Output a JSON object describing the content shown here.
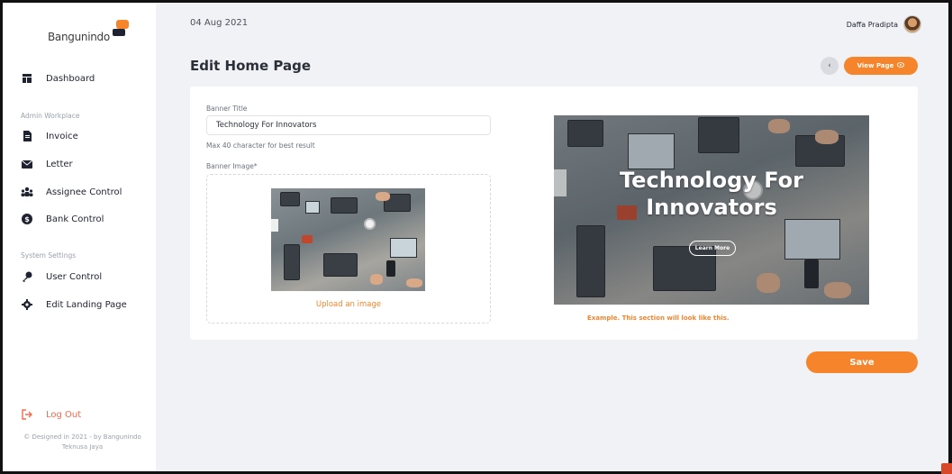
{
  "brand": {
    "name": "Bangunindo"
  },
  "sidebar": {
    "dashboard": "Dashboard",
    "admin_section": "Admin Workplace",
    "admin_items": [
      "Invoice",
      "Letter",
      "Assignee Control",
      "Bank Control"
    ],
    "system_section": "System Settings",
    "system_items": [
      "User Control",
      "Edit Landing Page"
    ],
    "logout": "Log Out",
    "footer_line1": "© Designed in 2021 - by Bangunindo",
    "footer_line2": "Teknusa Jaya"
  },
  "header": {
    "date": "04 Aug 2021",
    "user_name": "Daffa Pradipta",
    "page_title": "Edit Home Page",
    "view_page_label": "View Page"
  },
  "form": {
    "banner_title_label": "Banner Title",
    "banner_title_value": "Technology For Innovators",
    "banner_title_hint": "Max 40 character for best result",
    "banner_image_label": "Banner Image*",
    "upload_label": "Upload an image"
  },
  "preview": {
    "title_line1": "Technology For",
    "title_line2": "Innovators",
    "button_label": "Learn More",
    "example_note": "Example. This section will look like this."
  },
  "actions": {
    "save_label": "Save"
  },
  "colors": {
    "accent": "#f5842b",
    "sidebar_bg": "#ffffff",
    "main_bg": "#f1f2f6",
    "logout": "#f26b4f"
  },
  "icons": {
    "dashboard": "dashboard-icon",
    "invoice": "invoice-icon",
    "letter": "envelope-icon",
    "assignee": "users-icon",
    "bank": "dollar-icon",
    "user_control": "key-icon",
    "landing": "gear-icon",
    "logout": "logout-icon",
    "back": "chevron-left-icon",
    "view": "eye-icon"
  }
}
